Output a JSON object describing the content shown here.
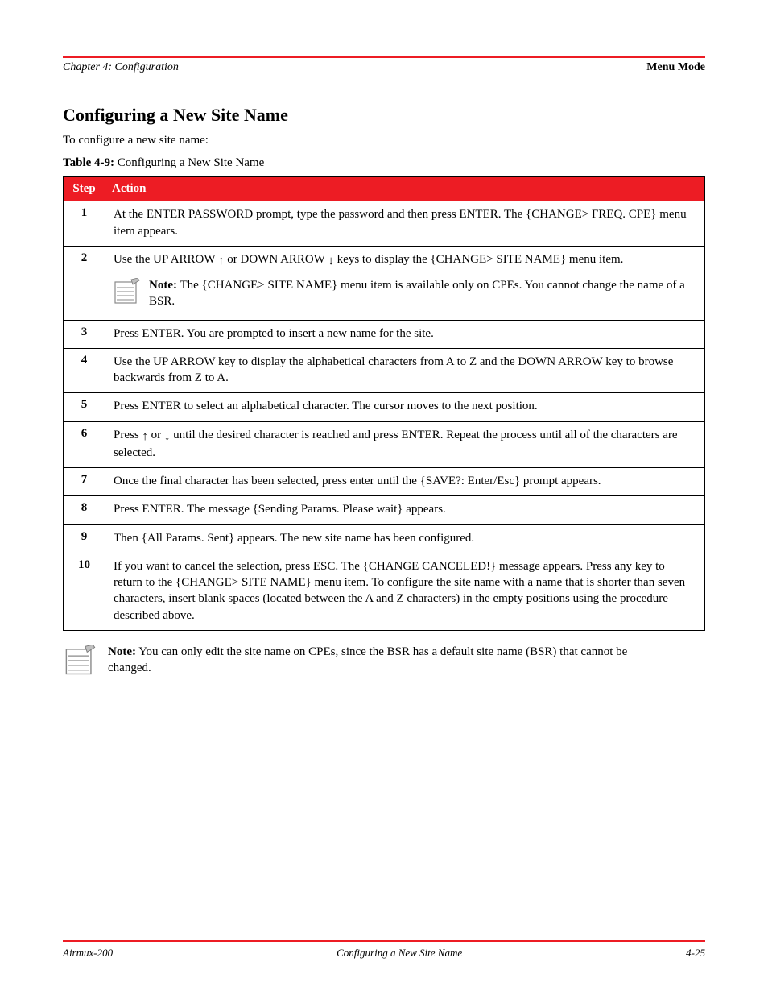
{
  "header": {
    "left": "Chapter 4: Configuration",
    "right": "Menu Mode"
  },
  "section": {
    "title": "Configuring a New Site Name",
    "intro": "To configure a new site name:",
    "table_caption_label": "Table 4-9: ",
    "table_caption_text": "Configuring a New Site Name"
  },
  "table": {
    "headers": {
      "step": "Step",
      "action": "Action"
    },
    "rows": [
      {
        "step": "1",
        "action": "At the ENTER PASSWORD prompt, type the password and then press ENTER. The {CHANGE> FREQ. CPE} menu item appears."
      },
      {
        "step": "2",
        "action_pre": "Use the UP ARROW ",
        "action_mid": " or DOWN ARROW ",
        "action_post": " keys to display the {CHANGE> SITE NAME} menu item.",
        "note": "Note: The {CHANGE> SITE NAME} menu item is available only on CPEs. You cannot change the name of a BSR."
      },
      {
        "step": "3",
        "action": "Press ENTER. You are prompted to insert a new name for the site."
      },
      {
        "step": "4",
        "action": "Use the UP ARROW key to display the alphabetical characters from A to Z and the DOWN ARROW key to browse backwards from Z to A."
      },
      {
        "step": "5",
        "action": "Press ENTER to select an alphabetical character. The cursor moves to the next position."
      },
      {
        "step": "6",
        "action_pre": "Press ",
        "action_mid": " or ",
        "action_post": " until the desired character is reached and press ENTER. Repeat the process until all of the characters are selected."
      },
      {
        "step": "7",
        "action": "Once the final character has been selected, press enter until the {SAVE?: Enter/Esc} prompt appears."
      },
      {
        "step": "8",
        "action": "Press ENTER. The message {Sending Params. Please wait} appears."
      },
      {
        "step": "9",
        "action": "Then {All Params. Sent} appears. The new site name has been configured."
      },
      {
        "step": "10",
        "action": "If you want to cancel the selection, press ESC. The {CHANGE CANCELED!} message appears. Press any key to return to the {CHANGE> SITE NAME} menu item. To configure the site name with a name that is shorter than seven characters, insert blank spaces (located between the A and Z characters) in the empty positions using the procedure described above."
      }
    ]
  },
  "outside_note": "Note: You can only edit the site name on CPEs, since the BSR has a default site name (BSR) that cannot be changed.",
  "footer": {
    "left": "Airmux-200",
    "center": "Configuring a New Site Name",
    "right": "4-25"
  },
  "icons": {
    "up_arrow": "↑",
    "down_arrow": "↓"
  }
}
